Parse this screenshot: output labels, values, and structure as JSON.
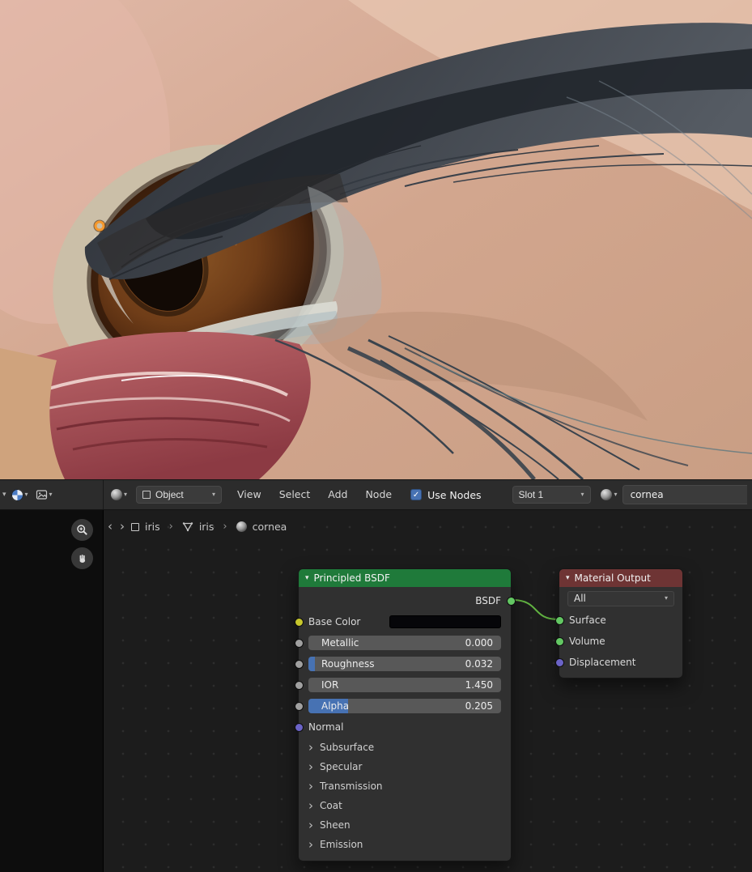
{
  "icons": {
    "dropdown_chevron": "▾",
    "collapse_chevron": "▾",
    "expand_chevron": "›",
    "check": "✓",
    "back": "‹",
    "forward": "›",
    "separator": "›"
  },
  "colors": {
    "accent_blue": "#4772b3",
    "node_header_green": "#1f7a3a",
    "node_header_red": "#6e3434",
    "wire_green": "#62b442",
    "socket_green": "#63c763",
    "socket_yellow": "#c7c72c",
    "socket_float_gray": "#a0a0a0",
    "socket_vector_purple": "#6b63c7",
    "origin_point_orange": "#f5982c"
  },
  "header": {
    "shader_type_label": "Object",
    "menus": [
      "View",
      "Select",
      "Add",
      "Node"
    ],
    "use_nodes_label": "Use Nodes",
    "use_nodes_checked": true,
    "slot_label": "Slot 1",
    "material_name": "cornea"
  },
  "breadcrumb": {
    "items": [
      {
        "label": "iris"
      },
      {
        "label": "iris"
      },
      {
        "label": "cornea"
      }
    ]
  },
  "nodes": {
    "principled": {
      "title": "Principled BSDF",
      "output_label": "BSDF",
      "base_color_label": "Base Color",
      "sliders": [
        {
          "label": "Metallic",
          "value": "0.000",
          "fill_width": "0%"
        },
        {
          "label": "Roughness",
          "value": "0.032",
          "fill_width": "3.2%"
        },
        {
          "label": "IOR",
          "value": "1.450",
          "fill_width": "0%"
        },
        {
          "label": "Alpha",
          "value": "0.205",
          "fill_width": "20.5%"
        }
      ],
      "normal_label": "Normal",
      "sections": [
        {
          "label": "Subsurface"
        },
        {
          "label": "Specular"
        },
        {
          "label": "Transmission"
        },
        {
          "label": "Coat"
        },
        {
          "label": "Sheen"
        },
        {
          "label": "Emission"
        }
      ]
    },
    "material_output": {
      "title": "Material Output",
      "target_value": "All",
      "inputs": [
        {
          "label": "Surface"
        },
        {
          "label": "Volume"
        },
        {
          "label": "Displacement"
        }
      ]
    }
  }
}
